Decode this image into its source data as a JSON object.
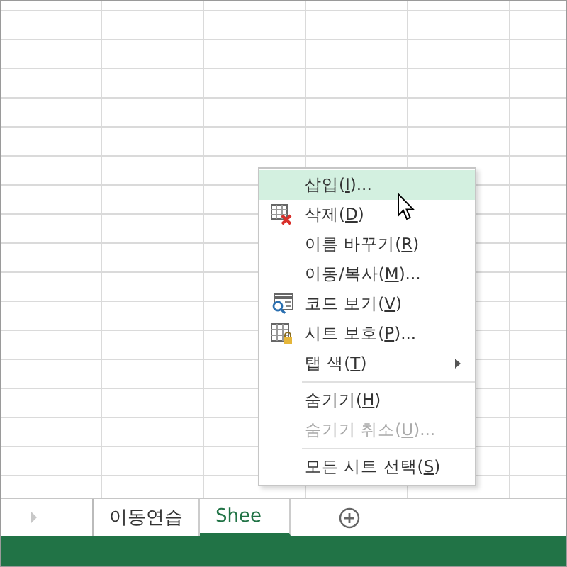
{
  "sheet_tabs": [
    {
      "label": "이동연습",
      "selected": false
    },
    {
      "label": "Shee",
      "selected": true
    }
  ],
  "context_menu": [
    {
      "label": "삽입(",
      "key": "I",
      "tail": ")...",
      "kind": "plain",
      "selected": true,
      "disabled": false,
      "submenu": false,
      "separator_before": false
    },
    {
      "label": "삭제(",
      "key": "D",
      "tail": ")",
      "kind": "delete",
      "selected": false,
      "disabled": false,
      "submenu": false,
      "separator_before": false
    },
    {
      "label": "이름 바꾸기(",
      "key": "R",
      "tail": ")",
      "kind": "plain",
      "selected": false,
      "disabled": false,
      "submenu": false,
      "separator_before": false
    },
    {
      "label": "이동/복사(",
      "key": "M",
      "tail": ")...",
      "kind": "plain",
      "selected": false,
      "disabled": false,
      "submenu": false,
      "separator_before": false
    },
    {
      "label": "코드 보기(",
      "key": "V",
      "tail": ")",
      "kind": "code",
      "selected": false,
      "disabled": false,
      "submenu": false,
      "separator_before": false
    },
    {
      "label": "시트 보호(",
      "key": "P",
      "tail": ")...",
      "kind": "protect",
      "selected": false,
      "disabled": false,
      "submenu": false,
      "separator_before": false
    },
    {
      "label": "탭 색(",
      "key": "T",
      "tail": ")",
      "kind": "plain",
      "selected": false,
      "disabled": false,
      "submenu": true,
      "separator_before": false
    },
    {
      "label": "숨기기(",
      "key": "H",
      "tail": ")",
      "kind": "plain",
      "selected": false,
      "disabled": false,
      "submenu": false,
      "separator_before": true
    },
    {
      "label": "숨기기 취소(",
      "key": "U",
      "tail": ")...",
      "kind": "plain",
      "selected": false,
      "disabled": true,
      "submenu": false,
      "separator_before": false
    },
    {
      "label": "모든 시트 선택(",
      "key": "S",
      "tail": ")",
      "kind": "plain",
      "selected": false,
      "disabled": false,
      "submenu": false,
      "separator_before": true
    }
  ]
}
